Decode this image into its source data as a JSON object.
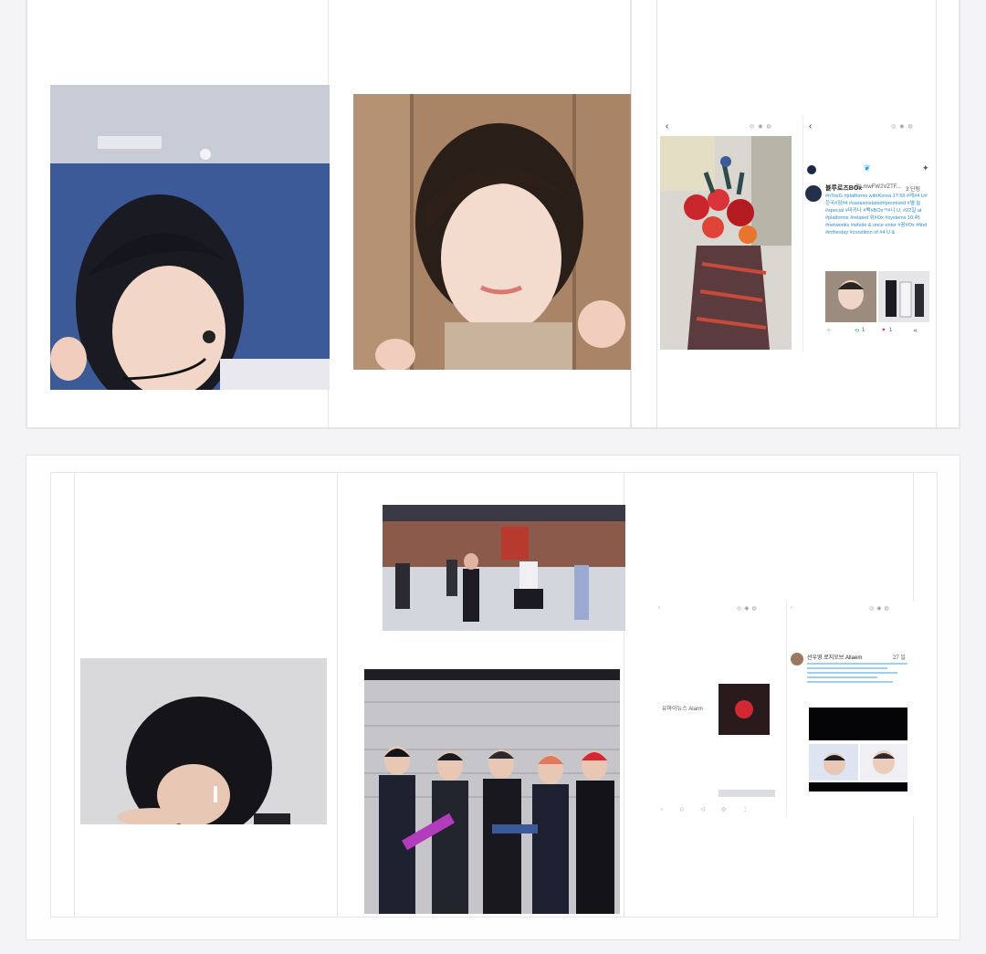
{
  "top_row": {
    "tweet_card": {
      "display_name": "블루로즈BOx",
      "handle": "@LmwFW2VZTF...",
      "time": "3 단됨",
      "body": "#nToxG #platforms withKorea 17:56 #케#4 U#한국#점#4 #sasaxmstatsd#promised #별 늘 #special #마카나 #백#BOxㅋ#나 U, #22일 at #platforms #related 위#Ox #systems 10.45 #netwonks #whole & once enter #꿈#Ox #find #inthestay #condition of #4 U &",
      "reply_count": "1",
      "like_count": "1"
    }
  },
  "bottom_row": {
    "phone_small_text": "유마이뉴스 Alarm",
    "tweet2_name": "선우영 로지오브 Allaem",
    "tweet2_time": "27 일"
  },
  "colors": {
    "page_bg": "#f4f4f6",
    "panel_bg": "#fefefe",
    "twitter_blue": "#1da1f2",
    "link_blue": "#2a8fd0"
  },
  "icons": [
    "twitter-bird-icon",
    "back-chevron-icon",
    "sparkle-icon",
    "heart-icon",
    "retweet-icon",
    "reply-icon"
  ]
}
